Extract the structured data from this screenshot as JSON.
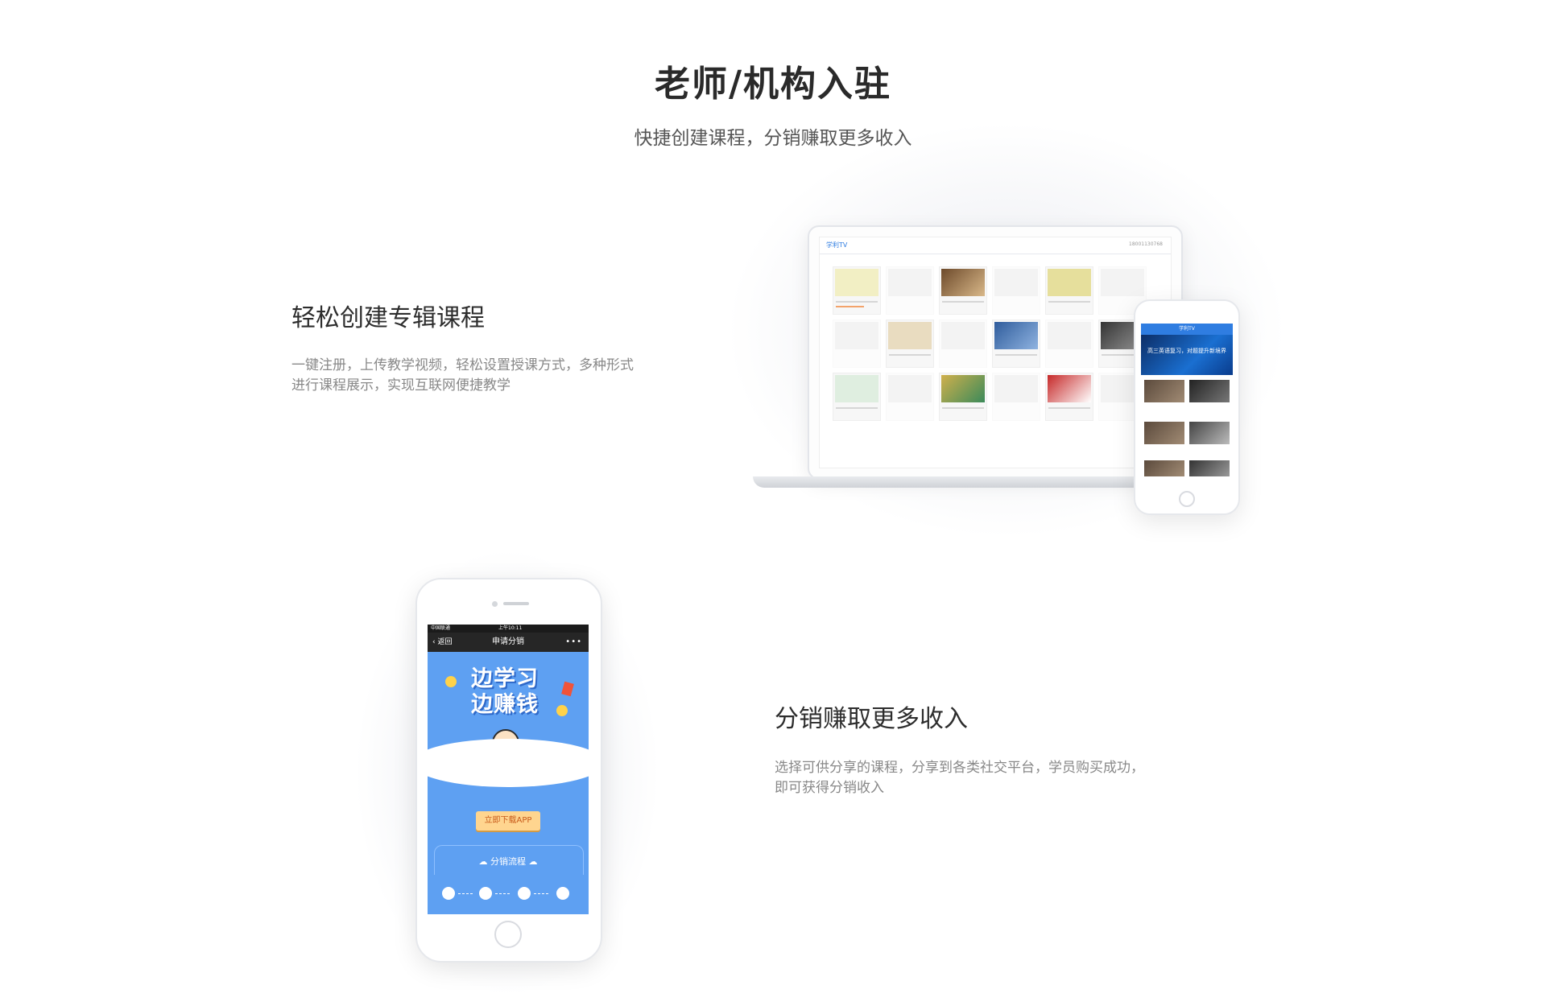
{
  "header": {
    "title": "老师/机构入驻",
    "subtitle": "快捷创建课程，分销赚取更多收入"
  },
  "section1": {
    "title": "轻松创建专辑课程",
    "desc_line1": "一键注册，上传教学视频，轻松设置授课方式，多种形式",
    "desc_line2": "进行课程展示，实现互联网便捷教学",
    "laptop": {
      "logo": "学利TV",
      "user": "18001130768"
    },
    "phone": {
      "header": "学利TV",
      "banner": "高三英语复习，对题提升新境界"
    }
  },
  "section2": {
    "title": "分销赚取更多收入",
    "desc_line1": "选择可供分享的课程，分享到各类社交平台，学员购买成功，",
    "desc_line2": "即可获得分销收入",
    "phone": {
      "carrier": "中国联通",
      "time": "上午10:11",
      "nav_back": "返回",
      "nav_title": "申请分销",
      "nav_more": "•••",
      "hero_line1": "边学习",
      "hero_line2": "边赚钱",
      "download_button": "立即下载APP",
      "flow_title": "分销流程"
    }
  },
  "colors": {
    "accent_blue": "#2f7de1",
    "promo_blue": "#5ea0f2",
    "download_bg": "#ffd58f"
  }
}
